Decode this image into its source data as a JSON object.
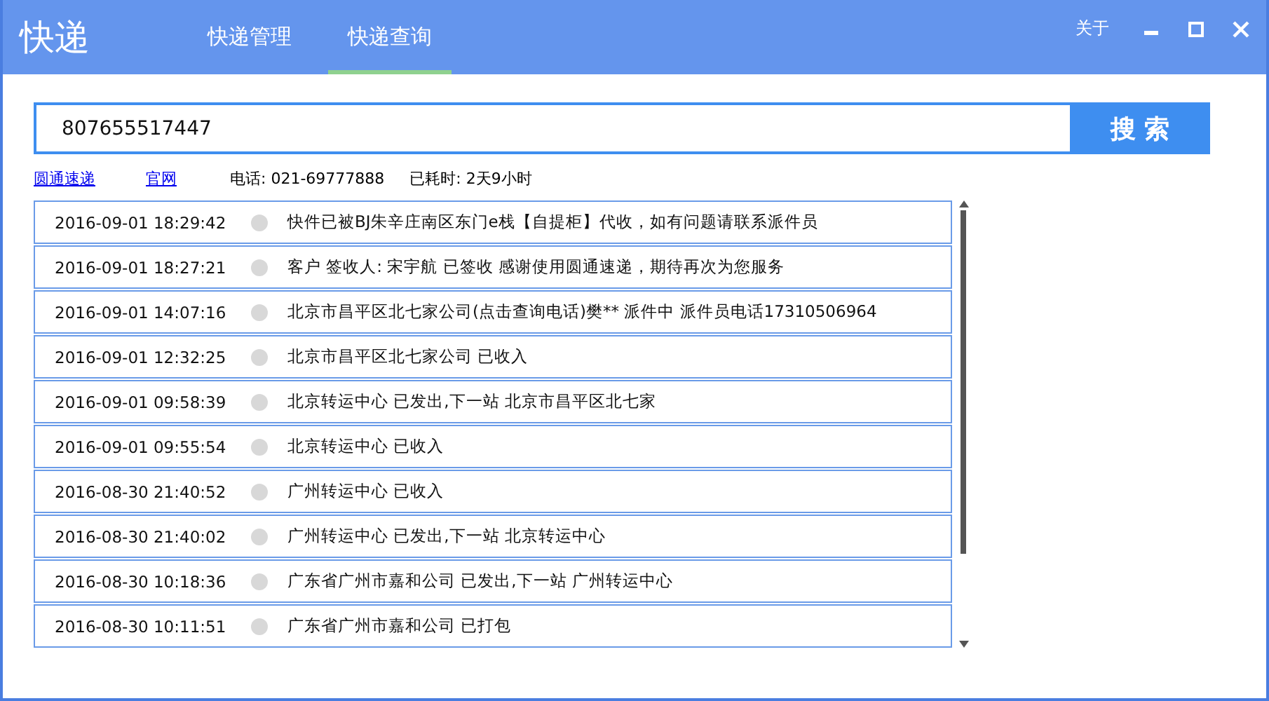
{
  "window": {
    "title": "快递",
    "about": "关于"
  },
  "tabs": [
    {
      "label": "快递管理",
      "selected": false
    },
    {
      "label": "快递查询",
      "selected": true
    }
  ],
  "search": {
    "value": "807655517447",
    "button": "搜 索"
  },
  "info": {
    "company_link": "圆通速递",
    "site_link": "官网",
    "phone": "电话: 021-69777888",
    "elapsed": "已耗时: 2天9小时"
  },
  "events": [
    {
      "time": "2016-09-01 18:29:42",
      "text": "快件已被BJ朱辛庄南区东门e栈【自提柜】代收，如有问题请联系派件员"
    },
    {
      "time": "2016-09-01 18:27:21",
      "text": "客户 签收人: 宋宇航 已签收 感谢使用圆通速递，期待再次为您服务"
    },
    {
      "time": "2016-09-01 14:07:16",
      "text": "北京市昌平区北七家公司(点击查询电话)樊** 派件中 派件员电话17310506964"
    },
    {
      "time": "2016-09-01 12:32:25",
      "text": "北京市昌平区北七家公司 已收入"
    },
    {
      "time": "2016-09-01 09:58:39",
      "text": "北京转运中心 已发出,下一站 北京市昌平区北七家"
    },
    {
      "time": "2016-09-01 09:55:54",
      "text": "北京转运中心 已收入"
    },
    {
      "time": "2016-08-30 21:40:52",
      "text": "广州转运中心 已收入"
    },
    {
      "time": "2016-08-30 21:40:02",
      "text": "广州转运中心 已发出,下一站 北京转运中心"
    },
    {
      "time": "2016-08-30 10:18:36",
      "text": "广东省广州市嘉和公司 已发出,下一站 广州转运中心"
    },
    {
      "time": "2016-08-30 10:11:51",
      "text": "广东省广州市嘉和公司 已打包"
    }
  ]
}
